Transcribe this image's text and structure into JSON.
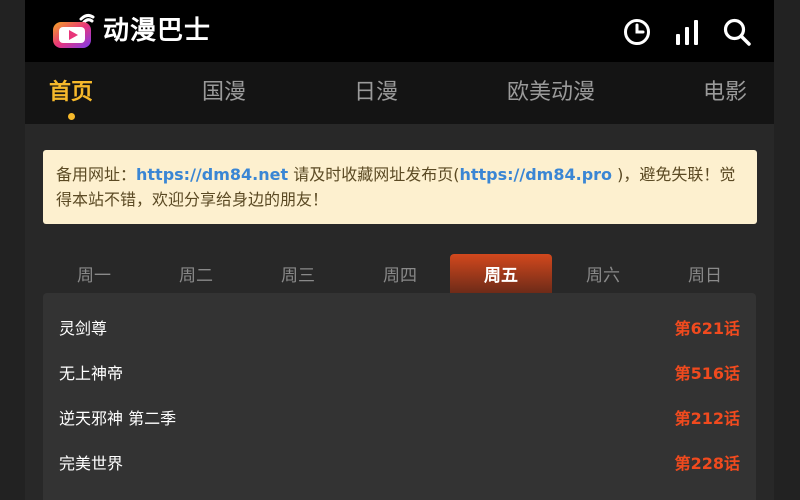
{
  "app": {
    "title": "动漫巴士"
  },
  "header": {
    "icons": [
      "history-icon",
      "ranking-icon",
      "search-icon"
    ]
  },
  "nav": {
    "items": [
      {
        "label": "首页",
        "active": true
      },
      {
        "label": "国漫"
      },
      {
        "label": "日漫"
      },
      {
        "label": "欧美动漫"
      },
      {
        "label": "电影"
      }
    ]
  },
  "notice": {
    "prefix": "备用网址：",
    "link1": "https://dm84.net",
    "middle": " 请及时收藏网址发布页(",
    "link2": "https://dm84.pro",
    "suffix": " )，避免失联！觉得本站不错，欢迎分享给身边的朋友！"
  },
  "weekdays": {
    "items": [
      "周一",
      "周二",
      "周三",
      "周四",
      "周五",
      "周六",
      "周日"
    ],
    "active": "周五"
  },
  "schedule": [
    {
      "title": "灵剑尊",
      "episode": "第621话"
    },
    {
      "title": "无上神帝",
      "episode": "第516话"
    },
    {
      "title": "逆天邪神 第二季",
      "episode": "第212话"
    },
    {
      "title": "完美世界",
      "episode": "第228话"
    }
  ],
  "colors": {
    "accent": "#f6b92b",
    "episode": "#f04a1e",
    "link": "#3a86d4",
    "notice_bg": "#fdf0cf"
  }
}
